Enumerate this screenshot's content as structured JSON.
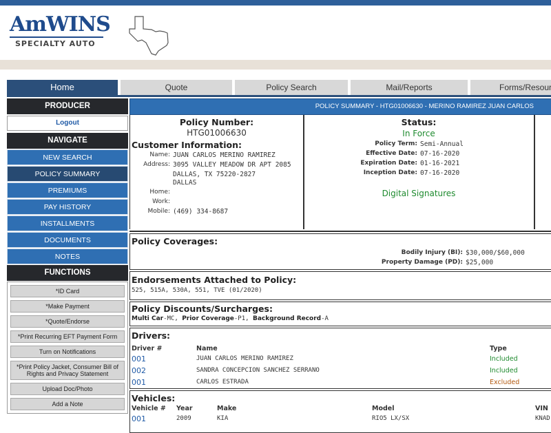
{
  "brand": {
    "name": "AmWINS",
    "subtitle": "SPECIALTY AUTO"
  },
  "tabs": [
    "Home",
    "Quote",
    "Policy Search",
    "Mail/Reports",
    "Forms/Resour"
  ],
  "sidebar": {
    "producer_header": "PRODUCER",
    "logout": "Logout",
    "navigate_header": "NAVIGATE",
    "nav_items": [
      "NEW SEARCH",
      "POLICY SUMMARY",
      "PREMIUMS",
      "PAY HISTORY",
      "INSTALLMENTS",
      "DOCUMENTS",
      "NOTES"
    ],
    "functions_header": "FUNCTIONS",
    "functions": [
      "*ID Card",
      "*Make Payment",
      "*Quote/Endorse",
      "*Print Recurring EFT Payment Form",
      "Turn on Notifications",
      "*Print Policy Jacket, Consumer Bill of Rights and Privacy Statement",
      "Upload Doc/Photo",
      "Add a Note"
    ]
  },
  "summary": {
    "header": "POLICY SUMMARY - HTG01006630 - MERINO RAMIREZ JUAN CARLOS",
    "policy_number_label": "Policy Number:",
    "policy_number": "HTG01006630",
    "customer_info_label": "Customer Information:",
    "name_label": "Name:",
    "name": "JUAN CARLOS MERINO RAMIREZ",
    "address_label": "Address:",
    "address_line1": "3095 VALLEY MEADOW DR APT 2085",
    "address_line2": "DALLAS, TX 75220-2827",
    "address_line3": "DALLAS",
    "home_label": "Home:",
    "work_label": "Work:",
    "mobile_label": "Mobile:",
    "mobile": "(469) 334-8687",
    "status_label": "Status:",
    "status": "In Force",
    "term_label": "Policy Term:",
    "term": "Semi-Annual",
    "effective_label": "Effective Date:",
    "effective": "07-16-2020",
    "expiration_label": "Expiration Date:",
    "expiration": "01-16-2021",
    "inception_label": "Inception Date:",
    "inception": "07-16-2020",
    "digital_signatures": "Digital Signatures"
  },
  "coverages": {
    "title": "Policy Coverages:",
    "items": [
      {
        "label": "Bodily Injury (BI):",
        "value": "$30,000/$60,000"
      },
      {
        "label": "Property Damage (PD):",
        "value": "$25,000"
      }
    ]
  },
  "endorsements": {
    "title": "Endorsements Attached to Policy:",
    "value": "525, 515A, 530A, 551, TVE (01/2020)"
  },
  "discounts": {
    "title": "Policy Discounts/Surcharges:",
    "items": [
      {
        "name": "Multi Car",
        "code": "-MC, "
      },
      {
        "name": "Prior Coverage",
        "code": "-P1, "
      },
      {
        "name": "Background Record",
        "code": "-A"
      }
    ]
  },
  "drivers": {
    "title": "Drivers:",
    "columns": [
      "Driver #",
      "Name",
      "Type"
    ],
    "rows": [
      {
        "num": "001",
        "name": "JUAN CARLOS MERINO RAMIREZ",
        "type": "Included"
      },
      {
        "num": "002",
        "name": "SANDRA CONCEPCION SANCHEZ SERRANO",
        "type": "Included"
      },
      {
        "num": "001",
        "name": "CARLOS ESTRADA",
        "type": "Excluded"
      }
    ]
  },
  "vehicles": {
    "title": "Vehicles:",
    "columns": [
      "Vehicle #",
      "Year",
      "Make",
      "Model",
      "VIN"
    ],
    "row": {
      "num": "001",
      "year": "2009",
      "make": "KIA",
      "model": "RIO5 LX/SX",
      "vin": "KNAD"
    }
  },
  "colors": {
    "brand_blue": "#1f4b8c",
    "nav_blue": "#2f6fb3",
    "dark": "#26282c",
    "in_force": "#1e8a2e",
    "excluded": "#b35a10"
  }
}
